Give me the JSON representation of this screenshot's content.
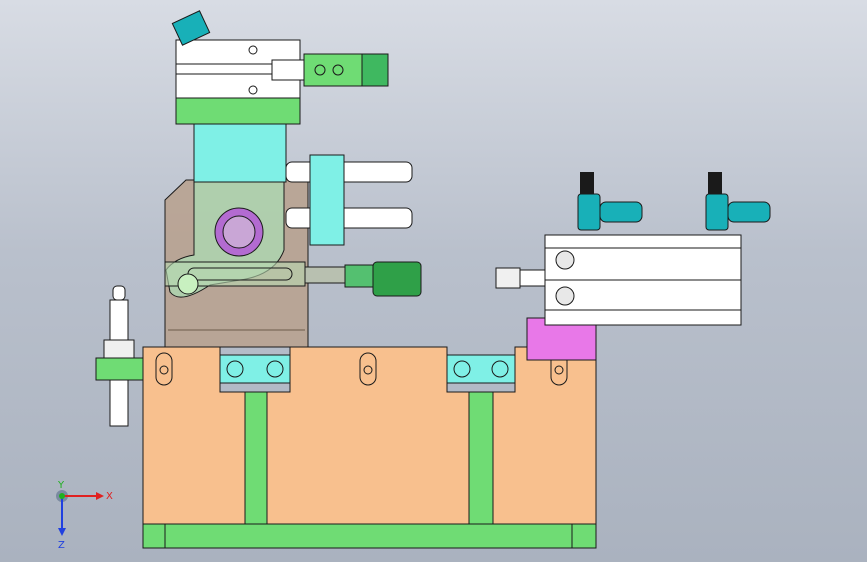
{
  "viewport": {
    "background_top": "#d8dce4",
    "background_bottom": "#aab2bf"
  },
  "triad": {
    "x_label": "X",
    "y_label": "Y",
    "z_label": "Z",
    "x_color": "#e02020",
    "y_color": "#20b020",
    "z_color": "#2040e0"
  },
  "colors": {
    "base_plate": "#f8c08e",
    "green_part": "#6fdc74",
    "cyan_part": "#7ff0e6",
    "bracket": "#b8a290",
    "magenta_block": "#e878e8",
    "cylinder_body": "#ffffff",
    "fitting": "#18b0b8",
    "edge": "#1a1a1a"
  }
}
